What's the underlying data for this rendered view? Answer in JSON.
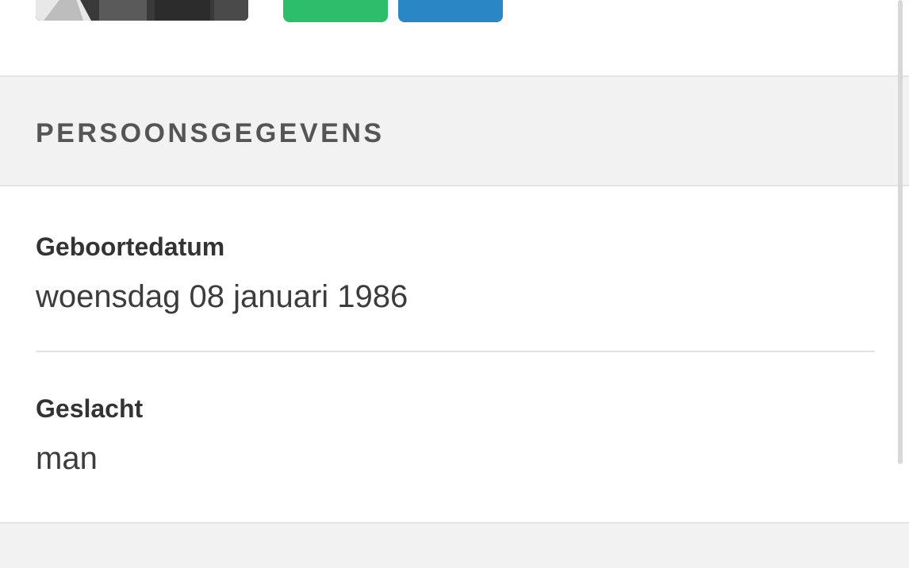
{
  "profile": {
    "photo_icon": "profile-photo",
    "actions": [
      {
        "name": "green-action-button",
        "color": "#2ebd6a"
      },
      {
        "name": "blue-action-button",
        "color": "#2a86c5"
      }
    ]
  },
  "personal_section": {
    "title": "PERSOONSGEGEVENS",
    "fields": {
      "dob": {
        "label": "Geboortedatum",
        "value": "woensdag 08 januari 1986"
      },
      "gender": {
        "label": "Geslacht",
        "value": "man"
      }
    }
  },
  "colors": {
    "section_bg": "#f2f2f2",
    "green": "#2ebd6a",
    "blue": "#2a86c5"
  }
}
